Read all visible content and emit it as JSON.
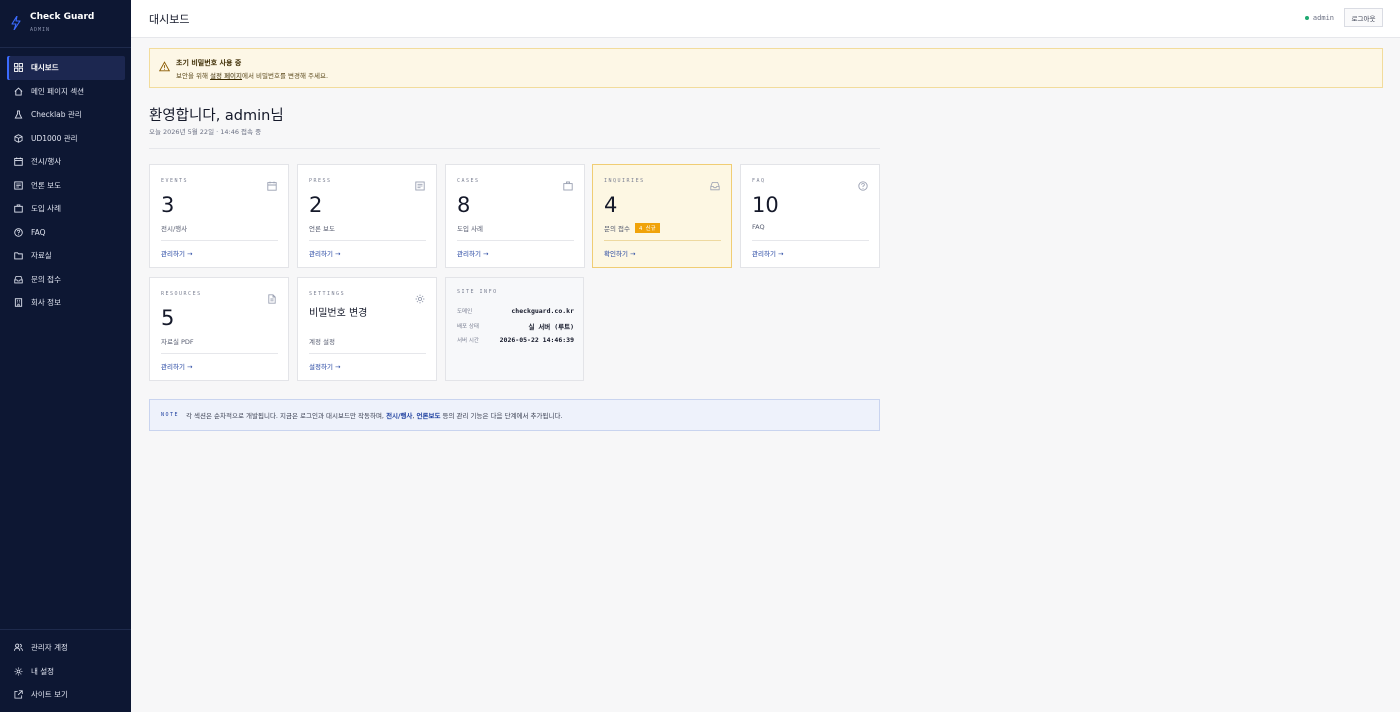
{
  "sidebar": {
    "brand_title": "Check Guard",
    "brand_sub": "ADMIN",
    "items": [
      {
        "label": "대시보드",
        "icon": "grid-icon"
      },
      {
        "label": "메인 페이지 섹션",
        "icon": "home-icon"
      },
      {
        "label": "Checklab 관리",
        "icon": "flask-icon"
      },
      {
        "label": "UD1000 관리",
        "icon": "box-icon"
      },
      {
        "label": "전시/행사",
        "icon": "calendar-icon"
      },
      {
        "label": "언론 보도",
        "icon": "newspaper-icon"
      },
      {
        "label": "도입 사례",
        "icon": "briefcase-icon"
      },
      {
        "label": "FAQ",
        "icon": "help-circle-icon"
      },
      {
        "label": "자료실",
        "icon": "folder-icon"
      },
      {
        "label": "문의 접수",
        "icon": "inbox-icon"
      },
      {
        "label": "회사 정보",
        "icon": "building-icon"
      }
    ],
    "bottom_items": [
      {
        "label": "관리자 계정",
        "icon": "users-icon"
      },
      {
        "label": "내 설정",
        "icon": "gear-icon"
      },
      {
        "label": "사이트 보기",
        "icon": "external-link-icon"
      }
    ]
  },
  "header": {
    "title": "대시보드",
    "user": "admin",
    "logout_label": "로그아웃"
  },
  "alert": {
    "title": "초기 비밀번호 사용 중",
    "body_prefix": "보안을 위해 ",
    "link": "설정 페이지",
    "body_suffix": "에서 비밀번호를 변경해 주세요."
  },
  "welcome": "환영합니다, admin님",
  "subline": "오늘 2026년 5월 22일 · 14:46 접속 중",
  "cards": [
    {
      "label": "EVENTS",
      "value": "3",
      "desc": "전시/행사",
      "link": "관리하기 →",
      "icon": "calendar-icon"
    },
    {
      "label": "PRESS",
      "value": "2",
      "desc": "언론 보도",
      "link": "관리하기 →",
      "icon": "newspaper-icon"
    },
    {
      "label": "CASES",
      "value": "8",
      "desc": "도입 사례",
      "link": "관리하기 →",
      "icon": "briefcase-icon"
    },
    {
      "label": "INQUIRIES",
      "value": "4",
      "desc": "문의 접수",
      "badge": "4 신규",
      "link": "확인하기 →",
      "icon": "inbox-icon"
    },
    {
      "label": "FAQ",
      "value": "10",
      "desc": "FAQ",
      "link": "관리하기 →",
      "icon": "help-circle-icon"
    },
    {
      "label": "RESOURCES",
      "value": "5",
      "desc": "자료실 PDF",
      "link": "관리하기 →",
      "icon": "file-icon"
    },
    {
      "label": "SETTINGS",
      "value": "비밀번호 변경",
      "desc": "계정 설정",
      "link": "설정하기 →",
      "icon": "gear-icon"
    }
  ],
  "site_info": {
    "label": "SITE INFO",
    "rows": [
      {
        "key": "도메인",
        "value": "checkguard.co.kr"
      },
      {
        "key": "배포 상태",
        "value": "실 서버 (루트)"
      },
      {
        "key": "서버 시간",
        "value": "2026-05-22 14:46:39"
      }
    ]
  },
  "note": {
    "tag": "NOTE",
    "prefix": "각 섹션은 순차적으로 개발됩니다. 지금은 로그인과 대시보드만 작동하며, ",
    "bold1": "전시/행사",
    "sep": ", ",
    "bold2": "언론보도",
    "suffix": " 등의 관리 기능은 다음 단계에서 추가됩니다."
  },
  "colors": {
    "sidebar_bg": "#0d1733",
    "accent": "#3b6bff",
    "link": "#1d3f9f",
    "warn_bg": "#fdf7e6",
    "badge": "#f0a30a"
  }
}
